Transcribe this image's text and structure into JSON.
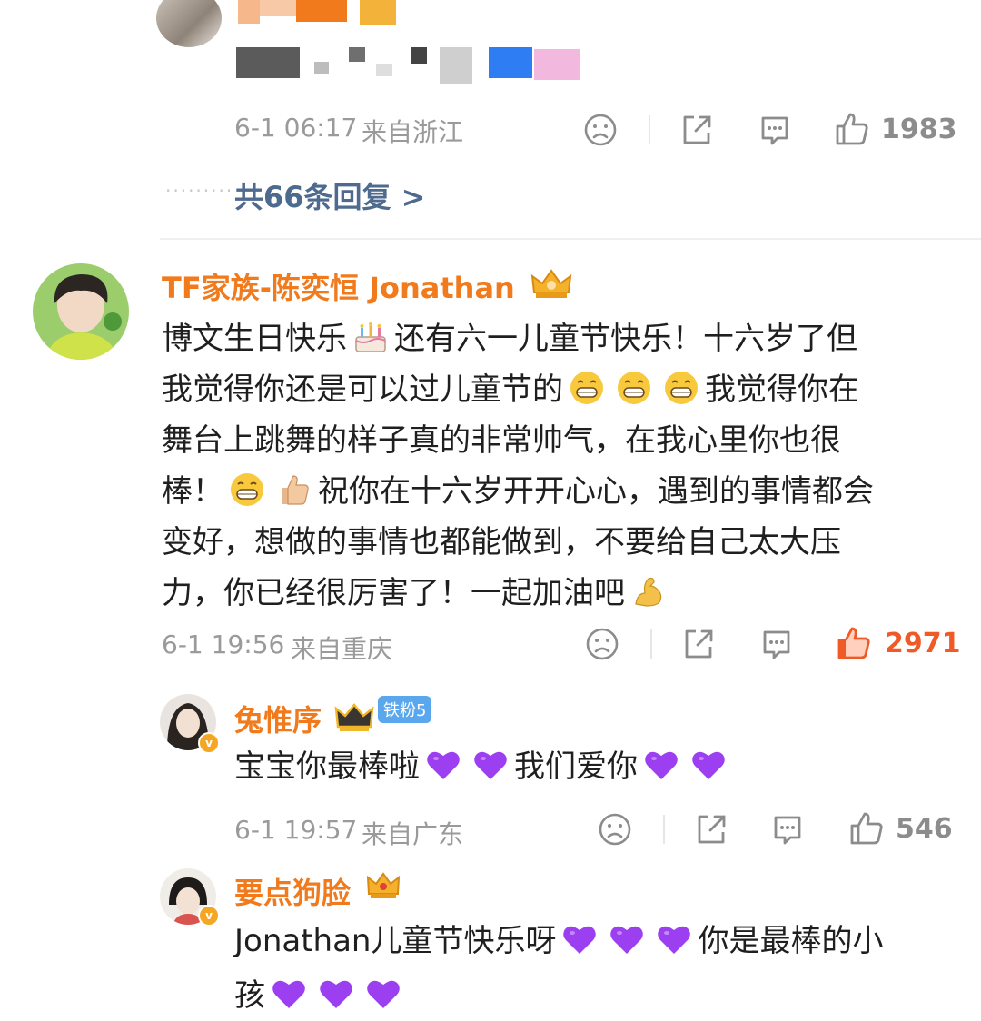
{
  "top_comment": {
    "time": "6-1 06:17",
    "location": "来自浙江",
    "likes": "1983",
    "replies_link": "共66条回复 >"
  },
  "comments": [
    {
      "user": "TF家族-陈奕恒 Jonathan",
      "text_lines": [
        "博文生日快乐",
        "还有六一儿童节快乐！十六岁了但",
        "我觉得你还是可以过儿童节的",
        "我觉得你在",
        "舞台上跳舞的样子真的非常帅气，在我心里你也很",
        "棒！",
        "祝你在十六岁开开心心，遇到的事情都会",
        "变好，想做的事情也都能做到，不要给自己太大压",
        "力，你已经很厉害了！一起加油吧"
      ],
      "time": "6-1 19:56",
      "location": "来自重庆",
      "likes": "2971"
    },
    {
      "user": "兔惟序",
      "fan_badge": "铁粉5",
      "text_a": "宝宝你最棒啦",
      "text_b": "我们爱你",
      "time": "6-1 19:57",
      "location": "来自广东",
      "likes": "546"
    },
    {
      "user": "要点狗脸",
      "text_a": "Jonathan儿童节快乐呀",
      "text_b": "你是最棒的小",
      "text_c": "孩"
    }
  ],
  "icons": {
    "dislike": "sad-face-icon",
    "share": "share-icon",
    "comment": "comment-icon",
    "like": "thumbs-up-icon",
    "heart": "purple-heart-emoji"
  },
  "colors": {
    "username": "#f07a1c",
    "link": "#4f6a8f",
    "like_active": "#ef5a26",
    "heart": "#9b3ff0"
  }
}
